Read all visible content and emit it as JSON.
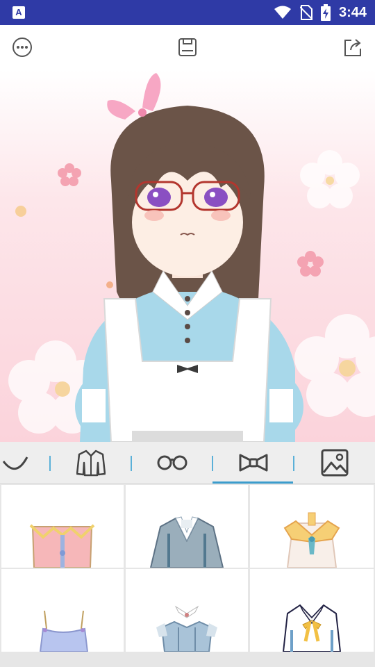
{
  "status_bar": {
    "app_badge": "A",
    "time": "3:44",
    "icons": [
      "wifi-icon",
      "no-sim-icon",
      "battery-charging-icon"
    ]
  },
  "toolbar": {
    "buttons": [
      "more-options-icon",
      "save-icon",
      "share-icon"
    ]
  },
  "colors": {
    "status_bar": "#2f3aa6",
    "accent": "#3b9ccc",
    "tab_background": "#eeeeee",
    "stage_pink": "#fbd3db"
  },
  "category_tabs": [
    {
      "name": "face",
      "icon": "smile-icon",
      "selected": false
    },
    {
      "name": "outfit",
      "icon": "jacket-icon",
      "selected": false
    },
    {
      "name": "glasses",
      "icon": "glasses-icon",
      "selected": false
    },
    {
      "name": "accessory",
      "icon": "bow-tie-icon",
      "selected": true
    },
    {
      "name": "background",
      "icon": "image-icon",
      "selected": false
    }
  ],
  "items": [
    {
      "name": "pink-frilled-top"
    },
    {
      "name": "blue-hanfu-robe"
    },
    {
      "name": "white-blouse-orange-trim"
    },
    {
      "name": "lavender-camisole"
    },
    {
      "name": "striped-corset-top"
    },
    {
      "name": "white-shirt-yellow-bow"
    }
  ]
}
